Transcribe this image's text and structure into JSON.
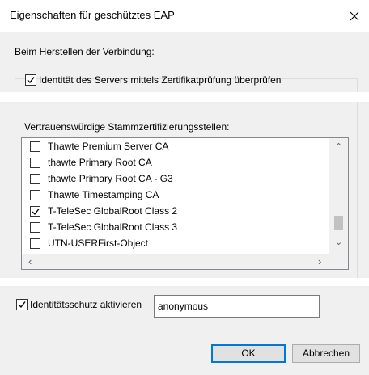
{
  "window": {
    "title": "Eigenschaften für geschütztes EAP",
    "close_label": "close"
  },
  "connection": {
    "heading": "Beim Herstellen der Verbindung:",
    "verify_server_label": "Identität des Servers mittels Zertifikatprüfung überprüfen",
    "verify_server_checked": true
  },
  "certificates": {
    "label": "Vertrauenswürdige Stammzertifizierungsstellen:",
    "items": [
      {
        "name": "Thawte Premium Server CA",
        "checked": false
      },
      {
        "name": "thawte Primary Root CA",
        "checked": false
      },
      {
        "name": "thawte Primary Root CA - G3",
        "checked": false
      },
      {
        "name": "Thawte Timestamping CA",
        "checked": false
      },
      {
        "name": "T-TeleSec GlobalRoot Class 2",
        "checked": true
      },
      {
        "name": "T-TeleSec GlobalRoot Class 3",
        "checked": false
      },
      {
        "name": "UTN-USERFirst-Object",
        "checked": false
      }
    ]
  },
  "identity": {
    "protection_label": "Identitätsschutz aktivieren",
    "protection_checked": true,
    "value": "anonymous"
  },
  "buttons": {
    "ok": "OK",
    "cancel": "Abbrechen"
  },
  "colors": {
    "accent": "#0078d7",
    "panel": "#f0f0f0"
  }
}
